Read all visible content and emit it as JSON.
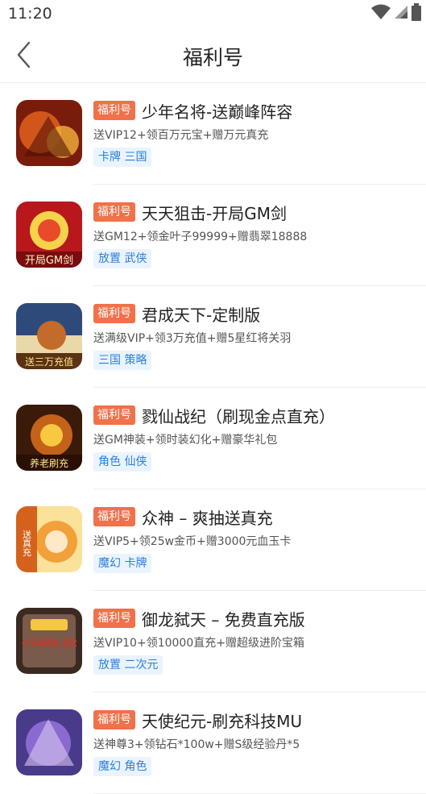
{
  "status_bar": {
    "time": "11:20",
    "icons": [
      "wifi-icon",
      "cellular-signal-icon",
      "battery-icon"
    ]
  },
  "header": {
    "title": "福利号",
    "back_icon": "chevron-left-icon"
  },
  "colors": {
    "badge": "#f0714a",
    "tag_bg": "#eaf4ff",
    "tag_text": "#2d7fd8",
    "divider": "#eeeeee"
  },
  "games": [
    {
      "badge": "福利号",
      "name": "少年名将-送巅峰阵容",
      "desc": "送VIP12+领百万元宝+赠万元真充",
      "tags": "卡牌 三国",
      "icon_text": "",
      "icon_colors": [
        "#7a1c0c",
        "#d2561a",
        "#f3b13a"
      ]
    },
    {
      "badge": "福利号",
      "name": "天天狙击-开局GM剑",
      "desc": "送GM12+领金叶子99999+赠翡翠18888",
      "tags": "放置 武侠",
      "icon_text": "开局GM剑",
      "icon_colors": [
        "#b8171c",
        "#e84a2a",
        "#f6d34a"
      ]
    },
    {
      "badge": "福利号",
      "name": "君成天下-定制版",
      "desc": "送满级VIP+领3万充值+赠5星红将关羽",
      "tags": "三国 策略",
      "icon_text": "送三万充值",
      "icon_colors": [
        "#2e4a7a",
        "#c26b2a",
        "#e9d9a8"
      ]
    },
    {
      "badge": "福利号",
      "name": "戮仙战纪（刷现金点直充）",
      "desc": "送GM神装+领时装幻化+赠豪华礼包",
      "tags": "角色 仙侠",
      "icon_text": "养老刷充",
      "icon_colors": [
        "#3a1a08",
        "#c4621a",
        "#f7c840"
      ]
    },
    {
      "badge": "福利号",
      "name": "众神 – 爽抽送真充",
      "desc": "送VIP5+领25w金币+赠3000元血玉卡",
      "tags": "魔幻 卡牌",
      "icon_text": "送真充",
      "icon_colors": [
        "#d4621c",
        "#f2a13a",
        "#fbe29a"
      ]
    },
    {
      "badge": "福利号",
      "name": "御龙弑天 – 免费直充版",
      "desc": "送VIP10+领10000直充+赠超级进阶宝箱",
      "tags": "放置 二次元",
      "icon_text": "+5484.02",
      "icon_colors": [
        "#3b2a22",
        "#7a5a4a",
        "#c9372a"
      ]
    },
    {
      "badge": "福利号",
      "name": "天使纪元-刷充科技MU",
      "desc": "送神尊3+领钻石*100w+赠S级经验丹*5",
      "tags": "魔幻 角色",
      "icon_text": "",
      "icon_colors": [
        "#4a3a8a",
        "#8a6ad0",
        "#d9c8f2"
      ]
    }
  ]
}
